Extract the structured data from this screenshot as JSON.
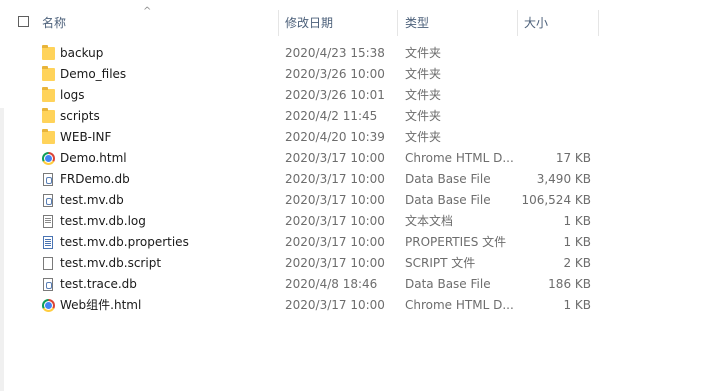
{
  "columns": {
    "name": "名称",
    "date": "修改日期",
    "type": "类型",
    "size": "大小"
  },
  "files": [
    {
      "name": "backup",
      "date": "2020/4/23 15:38",
      "type": "文件夹",
      "size": "",
      "icon": "folder-icon"
    },
    {
      "name": "Demo_files",
      "date": "2020/3/26 10:00",
      "type": "文件夹",
      "size": "",
      "icon": "folder-icon"
    },
    {
      "name": "logs",
      "date": "2020/3/26 10:01",
      "type": "文件夹",
      "size": "",
      "icon": "folder-icon"
    },
    {
      "name": "scripts",
      "date": "2020/4/2 11:45",
      "type": "文件夹",
      "size": "",
      "icon": "folder-icon"
    },
    {
      "name": "WEB-INF",
      "date": "2020/4/20 10:39",
      "type": "文件夹",
      "size": "",
      "icon": "folder-icon"
    },
    {
      "name": "Demo.html",
      "date": "2020/3/17 10:00",
      "type": "Chrome HTML D...",
      "size": "17 KB",
      "icon": "chrome-icon"
    },
    {
      "name": "FRDemo.db",
      "date": "2020/3/17 10:00",
      "type": "Data Base File",
      "size": "3,490 KB",
      "icon": "database-file-icon"
    },
    {
      "name": "test.mv.db",
      "date": "2020/3/17 10:00",
      "type": "Data Base File",
      "size": "106,524 KB",
      "icon": "database-file-icon"
    },
    {
      "name": "test.mv.db.log",
      "date": "2020/3/17 10:00",
      "type": "文本文档",
      "size": "1 KB",
      "icon": "text-file-icon"
    },
    {
      "name": "test.mv.db.properties",
      "date": "2020/3/17 10:00",
      "type": "PROPERTIES 文件",
      "size": "1 KB",
      "icon": "properties-file-icon"
    },
    {
      "name": "test.mv.db.script",
      "date": "2020/3/17 10:00",
      "type": "SCRIPT 文件",
      "size": "2 KB",
      "icon": "generic-file-icon"
    },
    {
      "name": "test.trace.db",
      "date": "2020/4/8 18:46",
      "type": "Data Base File",
      "size": "186 KB",
      "icon": "database-file-icon"
    },
    {
      "name": "Web组件.html",
      "date": "2020/3/17 10:00",
      "type": "Chrome HTML D...",
      "size": "1 KB",
      "icon": "chrome-icon"
    }
  ]
}
